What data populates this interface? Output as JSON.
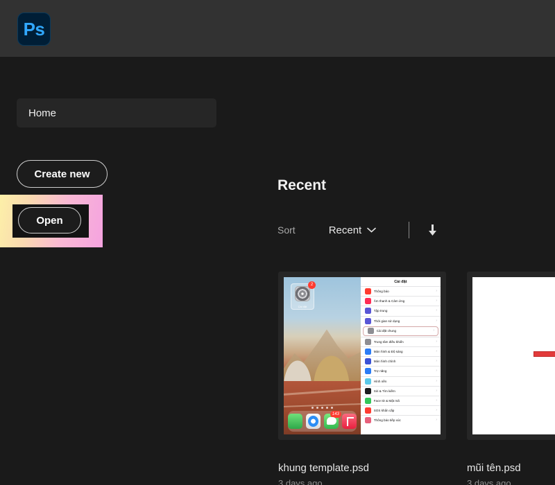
{
  "app": {
    "name": "Adobe Photoshop",
    "logo_text": "Ps",
    "logo_bg": "#001e36",
    "logo_fg": "#31a8ff"
  },
  "sidebar": {
    "items": [
      {
        "label": "Home",
        "selected": true
      }
    ],
    "buttons": [
      {
        "label": "Create new",
        "name": "create-new-button"
      },
      {
        "label": "Open",
        "name": "open-button",
        "highlighted": true
      }
    ]
  },
  "highlight": {
    "gradient_from": "#fcf0a8",
    "gradient_to": "#f5a3e0",
    "inner_bg": "#131313"
  },
  "recent": {
    "heading": "Recent",
    "sort_label": "Sort",
    "sort_value": "Recent",
    "chevron_icon": "chevron-down-icon",
    "download_icon": "download-arrow-icon",
    "files": [
      {
        "name": "khung template.psd",
        "modified": "3 days ago",
        "thumb_type": "ipad-settings-screenshot"
      },
      {
        "name": "mũi tên.psd",
        "modified": "3 days ago",
        "thumb_type": "white-canvas-red-arrow"
      }
    ]
  },
  "thumbnail_ipad": {
    "settings_title": "Cài đặt",
    "badge_count": "2",
    "app_icon_label": "Cài đặt",
    "settings_rows": [
      {
        "label": "Thông báo",
        "color": "#ff3b30"
      },
      {
        "label": "Âm thanh & Cảm ứng",
        "color": "#ff2d55"
      },
      {
        "label": "Tập trung",
        "color": "#5856d6"
      },
      {
        "label": "Thời gian sử dụng",
        "color": "#5856d6"
      },
      {
        "label": "Cài đặt chung",
        "color": "#8e8e93",
        "selected": true
      },
      {
        "label": "Trung tâm điều khiển",
        "color": "#8e8e93"
      },
      {
        "label": "Màn hình & Độ sáng",
        "color": "#2c7cf5"
      },
      {
        "label": "Màn hình chính",
        "color": "#3a52d6"
      },
      {
        "label": "Trợ năng",
        "color": "#2c7cf5"
      },
      {
        "label": "Hình nền",
        "color": "#5ac8e8"
      },
      {
        "label": "Siri & Tìm kiếm",
        "color": "#1c1c1e"
      },
      {
        "label": "Face ID & Mật mã",
        "color": "#34c759"
      },
      {
        "label": "SOS khẩn cấp",
        "color": "#ff3b30"
      },
      {
        "label": "Thông báo tiếp xúc",
        "color": "#e8607a"
      }
    ],
    "dock": [
      {
        "name": "phone-icon",
        "badge": ""
      },
      {
        "name": "safari-icon",
        "badge": ""
      },
      {
        "name": "messages-icon",
        "badge": "143"
      },
      {
        "name": "music-icon",
        "badge": ""
      }
    ]
  }
}
